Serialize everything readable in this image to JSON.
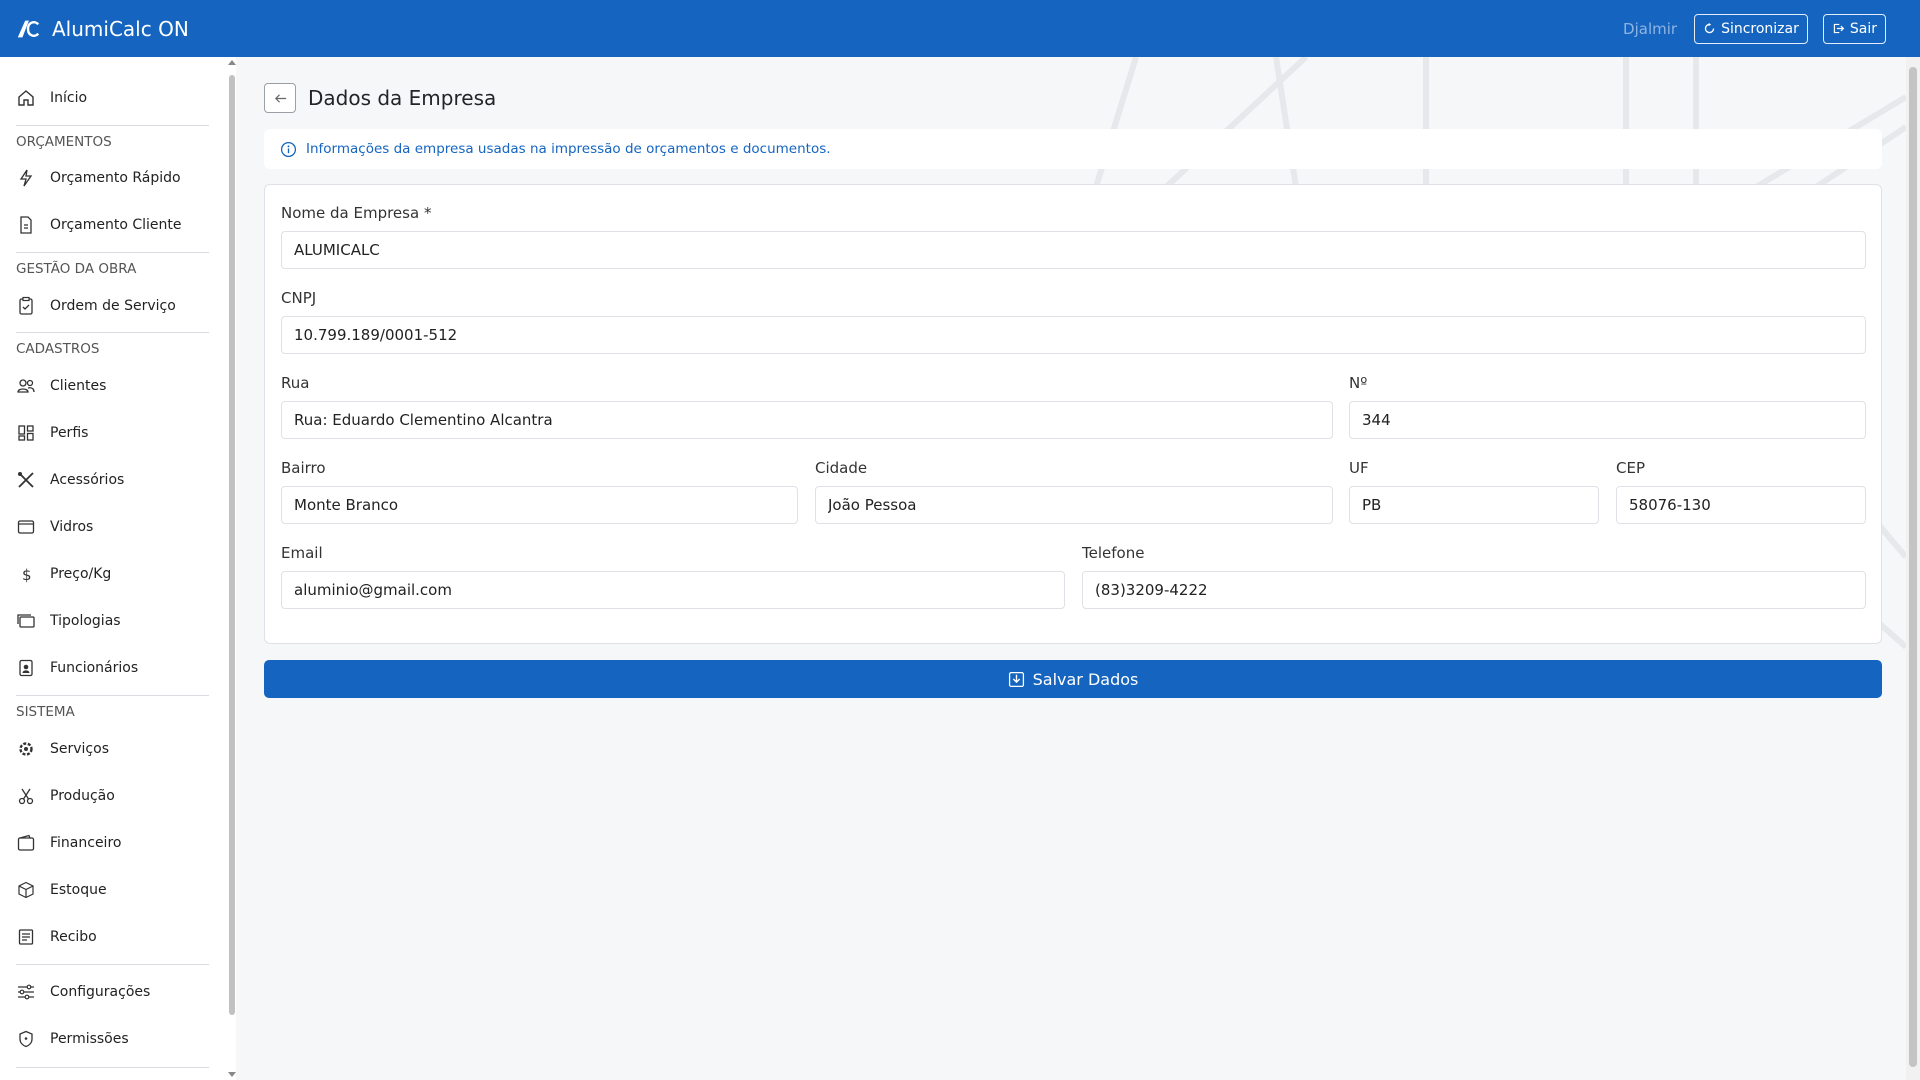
{
  "app": {
    "title": "AlumiCalc ON"
  },
  "header": {
    "user": "Djalmir",
    "sync_label": "Sincronizar",
    "logout_label": "Sair"
  },
  "sidebar": {
    "home": "Início",
    "sections": {
      "orcamentos": "ORÇAMENTOS",
      "gestao": "GESTÃO DA OBRA",
      "cadastros": "CADASTROS",
      "sistema": "SISTEMA"
    },
    "items": {
      "orcamento_rapido": "Orçamento Rápido",
      "orcamento_cliente": "Orçamento Cliente",
      "ordem_servico": "Ordem de Serviço",
      "clientes": "Clientes",
      "perfis": "Perfis",
      "acessorios": "Acessórios",
      "vidros": "Vidros",
      "preco_kg": "Preço/Kg",
      "tipologias": "Tipologias",
      "funcionarios": "Funcionários",
      "servicos": "Serviços",
      "producao": "Produção",
      "financeiro": "Financeiro",
      "estoque": "Estoque",
      "recibo": "Recibo",
      "configuracoes": "Configurações",
      "permissoes": "Permissões"
    }
  },
  "page": {
    "title": "Dados da Empresa",
    "info": "Informações da empresa usadas na impressão de orçamentos e documentos.",
    "save_label": "Salvar Dados"
  },
  "form": {
    "nome": {
      "label": "Nome da Empresa *",
      "value": "ALUMICALC"
    },
    "cnpj": {
      "label": "CNPJ",
      "value": "10.799.189/0001-512"
    },
    "rua": {
      "label": "Rua",
      "value": "Rua: Eduardo Clementino Alcantra"
    },
    "numero": {
      "label": "Nº",
      "value": "344"
    },
    "bairro": {
      "label": "Bairro",
      "value": "Monte Branco"
    },
    "cidade": {
      "label": "Cidade",
      "value": "João Pessoa"
    },
    "uf": {
      "label": "UF",
      "value": "PB"
    },
    "cep": {
      "label": "CEP",
      "value": "58076-130"
    },
    "email": {
      "label": "Email",
      "value": "aluminio@gmail.com"
    },
    "telefone": {
      "label": "Telefone",
      "value": "(83)3209-4222"
    }
  },
  "colors": {
    "primary": "#1565c0",
    "info_text": "#1565c0"
  }
}
